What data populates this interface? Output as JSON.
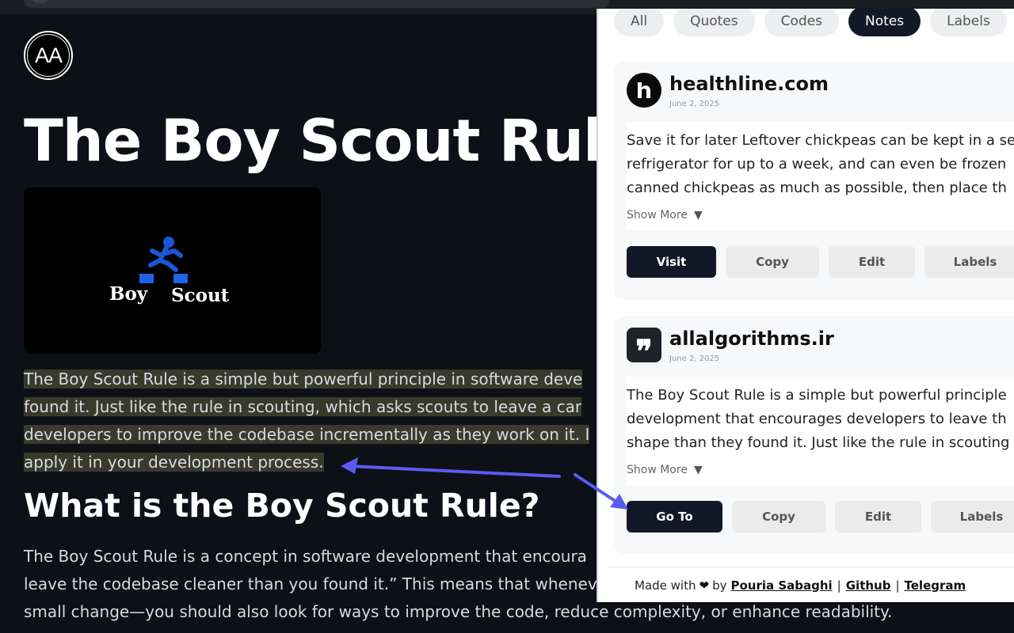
{
  "article": {
    "logo_text": "AA",
    "title": "The Boy Scout Rule",
    "hero": {
      "label_left": "Boy",
      "label_right": "Scout",
      "colors": {
        "figure": "#1a56d6",
        "text": "#ffffff",
        "accent": "#1f63e8"
      }
    },
    "highlighted_paragraph": [
      "The Boy Scout Rule is a simple but powerful principle in software deve",
      "found it. Just like the rule in scouting, which asks scouts to leave a car",
      "developers to improve the codebase incrementally as they work on it. I",
      "apply it in your development process."
    ],
    "heading": "What is the Boy Scout Rule?",
    "paragraph": [
      "The Boy Scout Rule is a concept in software development that encoura",
      "leave the codebase cleaner than you found it.” This means that whenev",
      "small change—you should also look for ways to improve the code, reduce complexity, or enhance readability."
    ]
  },
  "panel": {
    "filters": [
      "All",
      "Quotes",
      "Codes",
      "Notes",
      "Labels"
    ],
    "active_filter": "Notes",
    "cards": [
      {
        "icon": "healthline-icon",
        "domain": "healthline.com",
        "date": "June 2, 2025",
        "snippet": [
          "Save it for later Leftover chickpeas can be kept in a se",
          "refrigerator for up to a week, and can even be frozen",
          "canned chickpeas as much as possible, then place th"
        ],
        "show_more": "Show More",
        "actions": [
          "Visit",
          "Copy",
          "Edit",
          "Labels"
        ]
      },
      {
        "icon": "quote-icon",
        "domain": "allalgorithms.ir",
        "date": "June 2, 2025",
        "snippet": [
          "The Boy Scout Rule is a simple but powerful principle",
          "development that encourages developers to leave th",
          "shape than they found it. Just like the rule in scouting"
        ],
        "show_more": "Show More",
        "actions": [
          "Go To",
          "Copy",
          "Edit",
          "Labels"
        ]
      }
    ],
    "footer": {
      "made_with": "Made with",
      "by": "by",
      "author": "Pouria Sabaghi",
      "separator": "|",
      "github": "Github",
      "telegram": "Telegram"
    }
  },
  "annotations": {
    "arrow_color": "#5b5bf0"
  }
}
